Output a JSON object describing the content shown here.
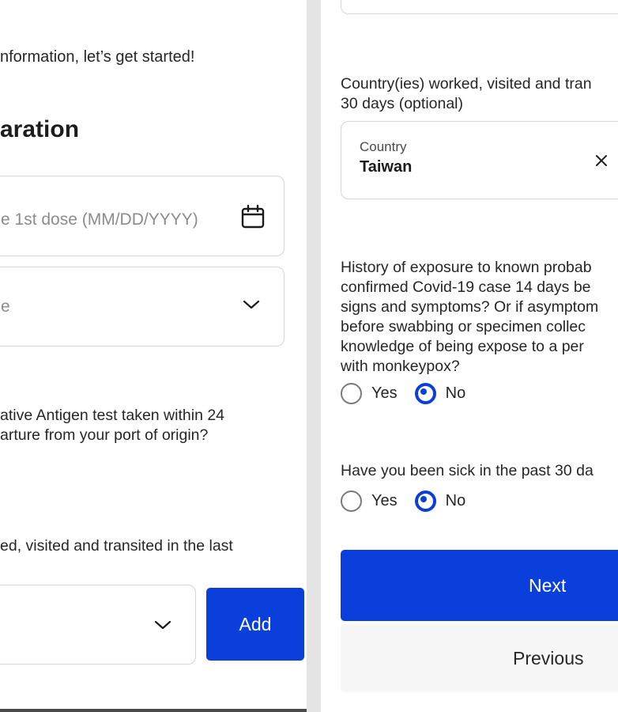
{
  "left": {
    "intro_text": "nformation, let’s get started!",
    "section_title": "aration",
    "vaccine_date_placeholder": "e 1st dose (MM/DD/YYYY)",
    "vaccine_type_placeholder": "e",
    "antigen_question_line1": "ative Antigen test taken within 24",
    "antigen_question_line2": "arture from your port of origin?",
    "countries_question": "ed, visited and transited in the last",
    "add_button": "Add"
  },
  "right": {
    "countries_label_line1": "Country(ies) worked, visited and tran",
    "countries_label_line2": "30 days (optional)",
    "country_field_label": "Country",
    "country_value": "Taiwan",
    "exposure_question_lines": [
      "History of exposure to known probab",
      "confirmed Covid-19 case 14 days be",
      "signs and symptoms? Or if asymptom",
      "before swabbing or specimen collec",
      "knowledge of being expose to a per",
      "with monkeypox?"
    ],
    "yes_label": "Yes",
    "no_label": "No",
    "sick_question": "Have you been sick in the past 30 da",
    "next_button": "Next",
    "previous_button": "Previous"
  },
  "colors": {
    "accent": "#0b3fdc"
  },
  "icons": [
    "calendar-icon",
    "chevron-down-icon",
    "close-icon"
  ]
}
